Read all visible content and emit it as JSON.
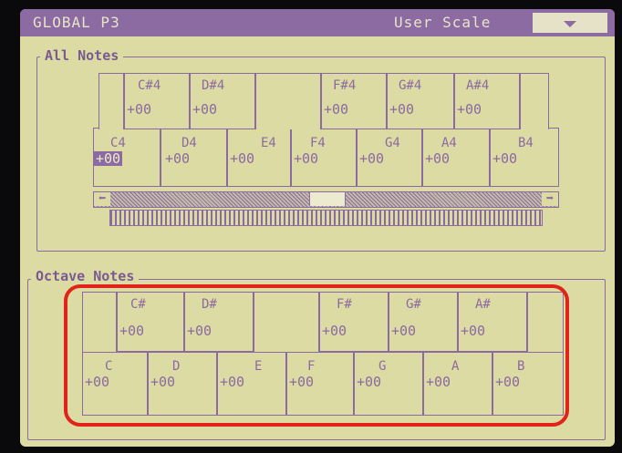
{
  "header": {
    "title": "GLOBAL  P3",
    "scale_label": "User Scale"
  },
  "all_notes": {
    "title": "All Notes",
    "white_keys": [
      {
        "name": "C4",
        "value": "+00",
        "selected": true
      },
      {
        "name": "D4",
        "value": "+00"
      },
      {
        "name": "E4",
        "value": "+00"
      },
      {
        "name": "F4",
        "value": "+00"
      },
      {
        "name": "G4",
        "value": "+00"
      },
      {
        "name": "A4",
        "value": "+00"
      },
      {
        "name": "B4",
        "value": "+00"
      }
    ],
    "black_keys": [
      {
        "name": "C#4",
        "value": "+00"
      },
      {
        "name": "D#4",
        "value": "+00"
      },
      {
        "name": "F#4",
        "value": "+00"
      },
      {
        "name": "G#4",
        "value": "+00"
      },
      {
        "name": "A#4",
        "value": "+00"
      }
    ],
    "scroll": {
      "left_arrow": "⬅",
      "right_arrow": "➡"
    }
  },
  "octave_notes": {
    "title": "Octave Notes",
    "white_keys": [
      {
        "name": "C",
        "value": "+00"
      },
      {
        "name": "D",
        "value": "+00"
      },
      {
        "name": "E",
        "value": "+00"
      },
      {
        "name": "F",
        "value": "+00"
      },
      {
        "name": "G",
        "value": "+00"
      },
      {
        "name": "A",
        "value": "+00"
      },
      {
        "name": "B",
        "value": "+00"
      }
    ],
    "black_keys": [
      {
        "name": "C#",
        "value": "+00"
      },
      {
        "name": "D#",
        "value": "+00"
      },
      {
        "name": "F#",
        "value": "+00"
      },
      {
        "name": "G#",
        "value": "+00"
      },
      {
        "name": "A#",
        "value": "+00"
      }
    ]
  },
  "colors": {
    "lcd_bg": "#dcdba3",
    "lcd_fg": "#8c6aa2",
    "highlight": "#e2231a"
  }
}
